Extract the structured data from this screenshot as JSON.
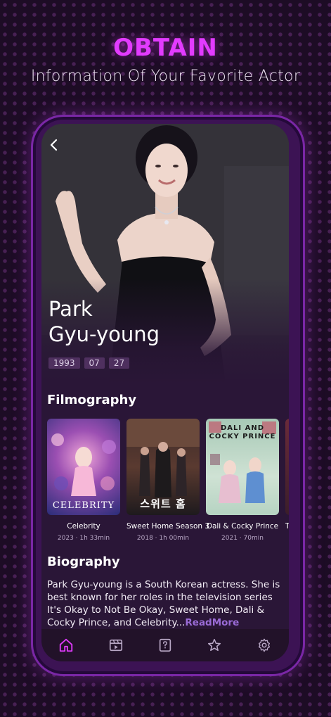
{
  "promo": {
    "headline": "OBTAIN",
    "subheadline": "Information Of Your Favorite Actor"
  },
  "actor": {
    "first_name": "Park",
    "last_name": "Gyu-young",
    "birth": {
      "year": "1993",
      "month": "07",
      "day": "27"
    }
  },
  "filmography": {
    "title": "Filmography",
    "items": [
      {
        "title": "Celebrity",
        "year": "2023",
        "runtime": "1h 33min",
        "poster_text": "CELEBRITY"
      },
      {
        "title": "Sweet Home Season 3",
        "year": "2018",
        "runtime": "1h 00min",
        "poster_text": "스위트 홈"
      },
      {
        "title": "Dali & Cocky Prince",
        "year": "2021",
        "runtime": "70min",
        "poster_text": "DALI AND COCKY PRINCE"
      },
      {
        "title": "T",
        "year": "",
        "runtime": "",
        "poster_text": ""
      }
    ]
  },
  "biography": {
    "title": "Biography",
    "text": "Park Gyu-young is a South Korean actress. She is best known for her roles in the television series It's Okay to Not Be Okay, Sweet Home, Dali & Cocky Prince, and Celebrity...",
    "read_more": "ReadMore"
  },
  "tabs": [
    {
      "icon": "home-icon",
      "active": true
    },
    {
      "icon": "film-icon",
      "active": false
    },
    {
      "icon": "quiz-icon",
      "active": false
    },
    {
      "icon": "star-icon",
      "active": false
    },
    {
      "icon": "gear-icon",
      "active": false
    }
  ],
  "colors": {
    "accent": "#e23bff",
    "background": "#1d0c25",
    "screen": "#2a1637",
    "read_more": "#9a6bd6",
    "tab_active": "#e23bff",
    "tab_inactive": "#b9a8c6"
  }
}
